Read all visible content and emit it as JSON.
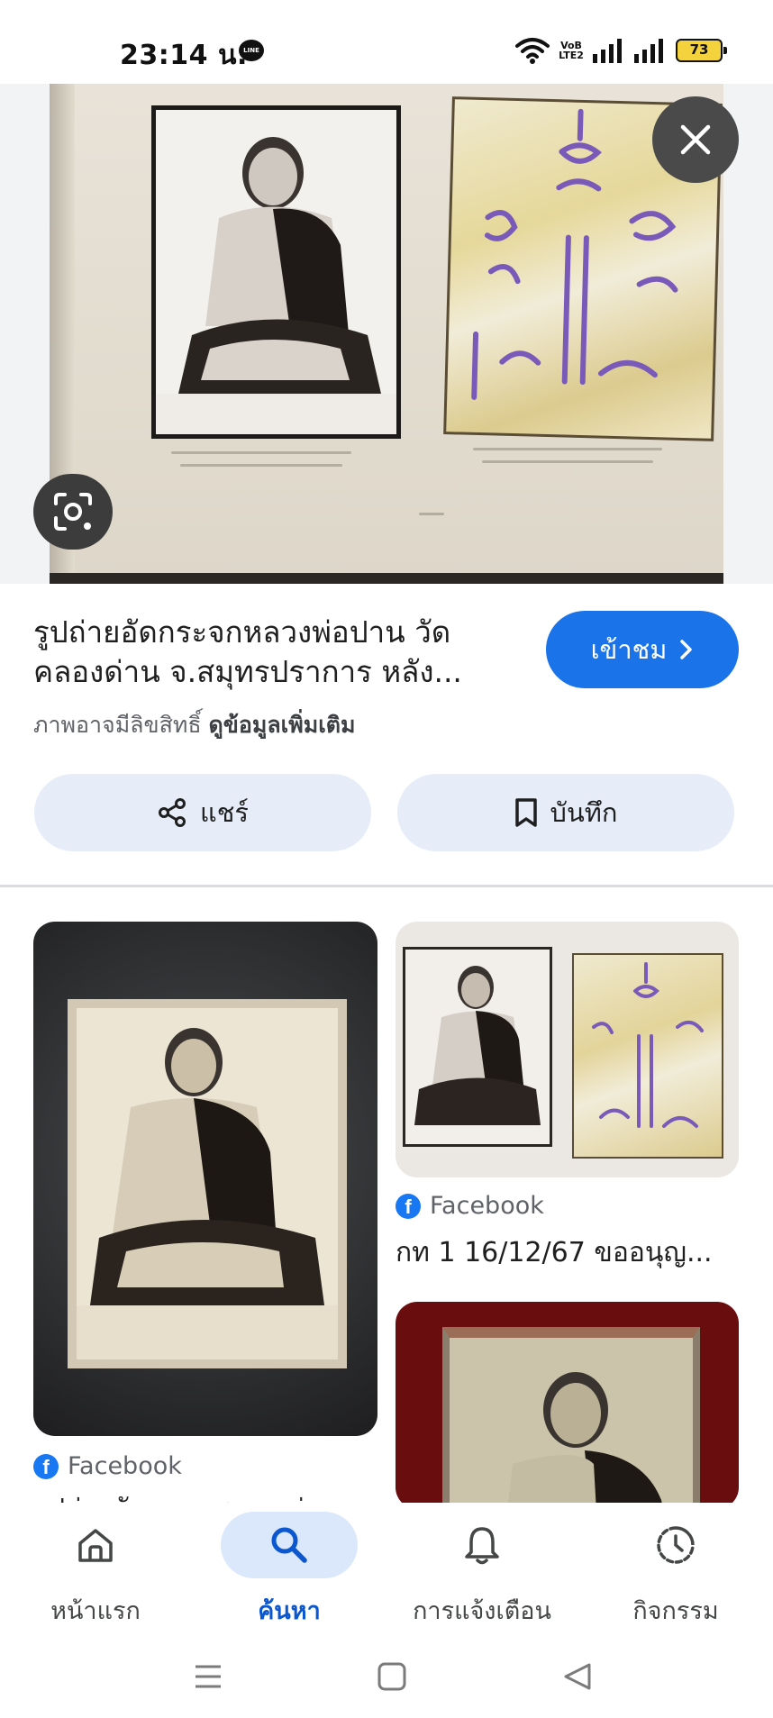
{
  "status_bar": {
    "time": "23:14 น.",
    "line_badge": "LINE",
    "volte_top": "VoB",
    "volte_bottom": "LTE2",
    "battery": "73"
  },
  "hero": {
    "icons": [
      "close-icon",
      "lens-icon"
    ]
  },
  "result": {
    "title": "รูปถ่ายอัดกระจกหลวงพ่อปาน วัดคลองด่าน จ.สมุทรปราการ หลัง...",
    "visit_label": "เข้าชม",
    "copyright_text": "ภาพอาจมีลิขสิทธิ์",
    "more_info": "ดูข้อมูลเพิ่มเติม",
    "share_label": "แชร์",
    "save_label": "บันทึก"
  },
  "related": [
    {
      "source": "Facebook",
      "title": "รูปถ่ายอัดกระจกหลวงพ่อ"
    },
    {
      "source": "Facebook",
      "title": "กท 1 16/12/67 ขออนุญ..."
    },
    {
      "source": "",
      "title": ""
    }
  ],
  "bottom_nav": {
    "items": [
      {
        "label": "หน้าแรก",
        "icon": "home-icon"
      },
      {
        "label": "ค้นหา",
        "icon": "search-icon",
        "active": true
      },
      {
        "label": "การแจ้งเตือน",
        "icon": "bell-icon"
      },
      {
        "label": "กิจกรรม",
        "icon": "activity-icon"
      }
    ]
  },
  "colors": {
    "accent": "#1a73e8",
    "active_nav_bg": "#dbe7fb",
    "action_button_bg": "#e6edf8",
    "facebook": "#1877f2"
  }
}
